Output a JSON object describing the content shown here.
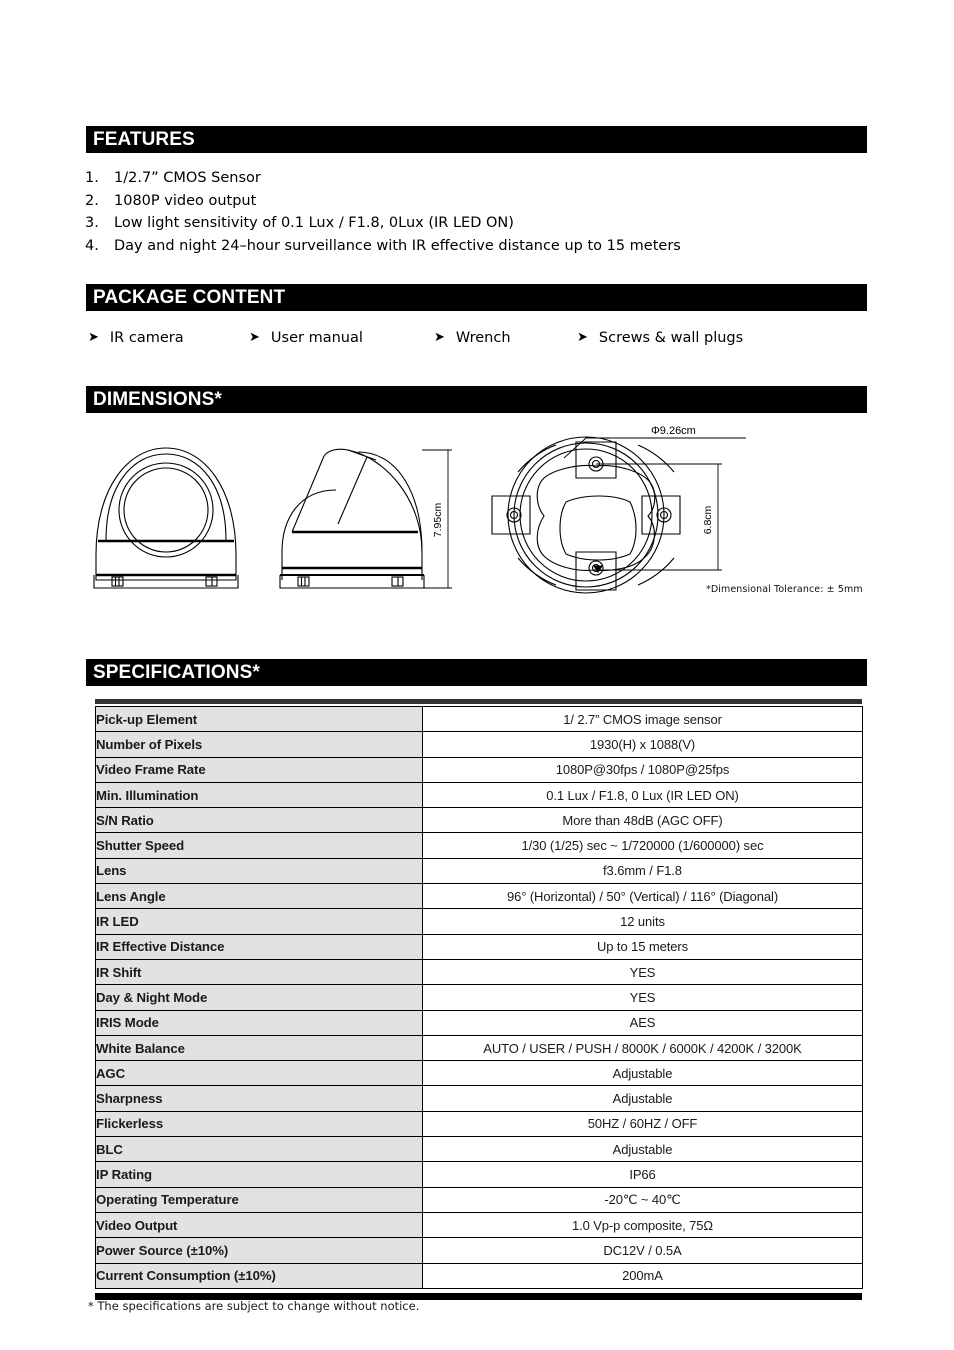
{
  "sections": {
    "features": {
      "title": "FEATURES"
    },
    "package": {
      "title": "PACKAGE CONTENT"
    },
    "dimensions": {
      "title": "DIMENSIONS*"
    },
    "specifications": {
      "title": "SPECIFICATIONS*"
    }
  },
  "features": {
    "items": [
      {
        "num": "1.",
        "text": "1/2.7” CMOS Sensor"
      },
      {
        "num": "2.",
        "text": "1080P video output"
      },
      {
        "num": "3.",
        "text": "Low light sensitivity of 0.1 Lux / F1.8, 0Lux (IR LED ON)"
      },
      {
        "num": "4.",
        "text": "Day and night 24–hour surveillance with IR effective distance up to 15 meters"
      }
    ]
  },
  "package": {
    "bullet": "➤",
    "items": [
      {
        "label": "IR camera"
      },
      {
        "label": "User manual"
      },
      {
        "label": "Wrench"
      },
      {
        "label": "Screws & wall plugs"
      }
    ]
  },
  "dimensions": {
    "height_label": "7.95cm",
    "diameter_label": "Φ9.26cm",
    "depth_label": "6.8cm",
    "tolerance_note": "*Dimensional Tolerance: ± 5mm"
  },
  "specifications": {
    "rows": [
      {
        "label": "Pick-up Element",
        "value": "1/ 2.7” CMOS image sensor"
      },
      {
        "label": "Number of Pixels",
        "value": "1930(H) x 1088(V)"
      },
      {
        "label": "Video Frame Rate",
        "value": "1080P@30fps / 1080P@25fps"
      },
      {
        "label": "Min. Illumination",
        "value": "0.1 Lux / F1.8, 0 Lux (IR LED ON)"
      },
      {
        "label": "S/N Ratio",
        "value": "More than 48dB (AGC OFF)"
      },
      {
        "label": "Shutter Speed",
        "value": "1/30 (1/25) sec ~ 1/720000 (1/600000) sec"
      },
      {
        "label": "Lens",
        "value": "f3.6mm / F1.8"
      },
      {
        "label": "Lens Angle",
        "value": "96° (Horizontal) / 50° (Vertical) / 116° (Diagonal)"
      },
      {
        "label": "IR LED",
        "value": "12 units"
      },
      {
        "label": "IR Effective Distance",
        "value": "Up to 15 meters"
      },
      {
        "label": "IR Shift",
        "value": "YES"
      },
      {
        "label": "Day & Night Mode",
        "value": "YES"
      },
      {
        "label": "IRIS Mode",
        "value": "AES"
      },
      {
        "label": "White Balance",
        "value": "AUTO / USER / PUSH / 8000K / 6000K / 4200K / 3200K"
      },
      {
        "label": "AGC",
        "value": "Adjustable"
      },
      {
        "label": "Sharpness",
        "value": "Adjustable"
      },
      {
        "label": "Flickerless",
        "value": "50HZ / 60HZ / OFF"
      },
      {
        "label": "BLC",
        "value": "Adjustable"
      },
      {
        "label": "IP Rating",
        "value": "IP66"
      },
      {
        "label": "Operating Temperature",
        "value": "-20℃ ~ 40℃"
      },
      {
        "label": "Video Output",
        "value": "1.0 Vp-p composite, 75Ω"
      },
      {
        "label": "Power Source (±10%)",
        "value": "DC12V / 0.5A"
      },
      {
        "label": "Current Consumption (±10%)",
        "value": "200mA"
      }
    ]
  },
  "footnote": {
    "text": "* The specifications are subject to change without notice."
  }
}
